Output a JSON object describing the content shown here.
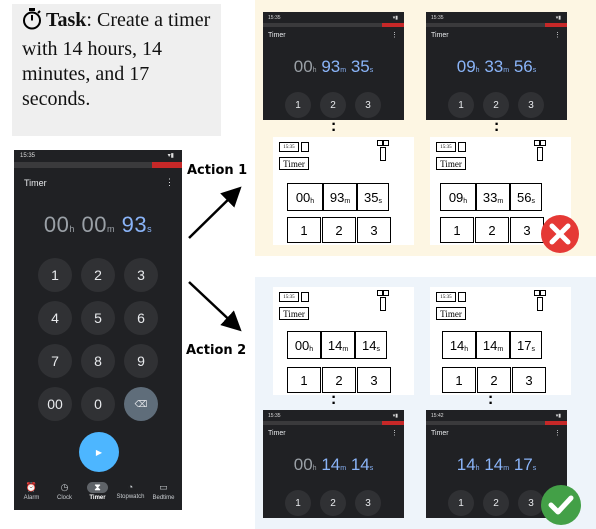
{
  "task": {
    "label": "Task",
    "text": ": Create a timer with 14 hours, 14 minutes, and 17 seconds."
  },
  "phone": {
    "status_time": "15:35",
    "app_title": "Timer",
    "display": {
      "h": "00",
      "h_unit": "h",
      "m": "00",
      "m_unit": "m",
      "s": "93",
      "s_unit": "s"
    },
    "keys": [
      "1",
      "2",
      "3",
      "4",
      "5",
      "6",
      "7",
      "8",
      "9",
      "00",
      "0"
    ],
    "backspace_glyph": "⌫",
    "fab_glyph": "▶",
    "nav": [
      {
        "label": "Alarm",
        "icon": "alarm-icon"
      },
      {
        "label": "Clock",
        "icon": "clock-icon"
      },
      {
        "label": "Timer",
        "icon": "hourglass-icon"
      },
      {
        "label": "Stopwatch",
        "icon": "stopwatch-icon"
      },
      {
        "label": "Bedtime",
        "icon": "bed-icon"
      }
    ]
  },
  "actions": {
    "action1": "Action 1",
    "action2": "Action 2"
  },
  "panel1": {
    "before": {
      "status": "15:35",
      "title": "Timer",
      "h": "00",
      "m": "93",
      "s": "35",
      "keys": [
        "1",
        "2",
        "3"
      ]
    },
    "after": {
      "status": "15:35",
      "title": "Timer",
      "h": "09",
      "m": "33",
      "s": "56",
      "keys": [
        "1",
        "2",
        "3"
      ]
    },
    "wire_before": {
      "status": "15:35",
      "title": "Timer",
      "h": "00",
      "m": "93",
      "s": "35",
      "keys": [
        "1",
        "2",
        "3"
      ]
    },
    "wire_after": {
      "status": "15:35",
      "title": "Timer",
      "h": "09",
      "m": "33",
      "s": "56",
      "keys": [
        "1",
        "2",
        "3"
      ]
    },
    "result": "wrong"
  },
  "panel2": {
    "wire_before": {
      "status": "15:35",
      "title": "Timer",
      "h": "00",
      "m": "14",
      "s": "14",
      "keys": [
        "1",
        "2",
        "3"
      ]
    },
    "wire_after": {
      "status": "15:35",
      "title": "Timer",
      "h": "14",
      "m": "14",
      "s": "17",
      "keys": [
        "1",
        "2",
        "3"
      ]
    },
    "before": {
      "status": "15:35",
      "title": "Timer",
      "h": "00",
      "m": "14",
      "s": "14",
      "keys": [
        "1",
        "2",
        "3"
      ]
    },
    "after": {
      "status": "15:42",
      "title": "Timer",
      "h": "14",
      "m": "14",
      "s": "17",
      "keys": [
        "1",
        "2",
        "3"
      ]
    },
    "result": "correct"
  },
  "units": {
    "h": "h",
    "m": "m",
    "s": "s"
  },
  "colors": {
    "accent": "#8ab4f8",
    "fab": "#4db6ff",
    "wrong": "#e53935",
    "correct": "#43a047"
  }
}
